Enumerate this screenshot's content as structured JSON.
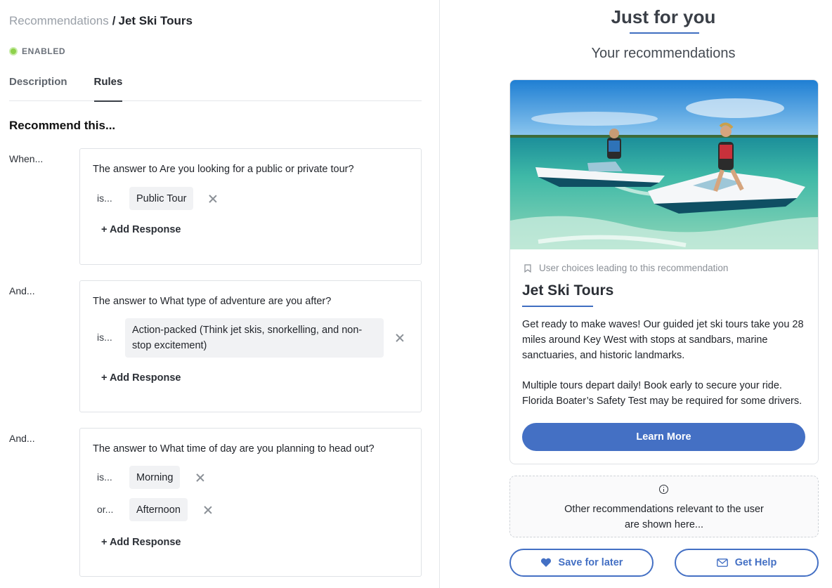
{
  "breadcrumb": {
    "parent": "Recommendations",
    "separator": "/",
    "current": "Jet Ski Tours"
  },
  "status": {
    "label": "ENABLED",
    "color": "#8ed14b"
  },
  "tabs": [
    {
      "label": "Description",
      "active": false
    },
    {
      "label": "Rules",
      "active": true
    }
  ],
  "rules": {
    "section_title": "Recommend this...",
    "conditions": [
      {
        "label": "When...",
        "question": "The answer to Are you looking for a public or private tour?",
        "responses": [
          {
            "op": "is...",
            "value": "Public Tour"
          }
        ],
        "add_label": "+ Add Response"
      },
      {
        "label": "And...",
        "question": "The answer to What type of adventure are you after?",
        "responses": [
          {
            "op": "is...",
            "value": "Action-packed (Think jet skis, snorkelling, and non-stop excitement)"
          }
        ],
        "add_label": "+ Add Response"
      },
      {
        "label": "And...",
        "question": "The answer to What time of day are you planning to head out?",
        "responses": [
          {
            "op": "is...",
            "value": "Morning"
          },
          {
            "op": "or...",
            "value": "Afternoon"
          }
        ],
        "add_label": "+ Add Response"
      }
    ]
  },
  "preview": {
    "heading": "Just for you",
    "subheading": "Your recommendations",
    "card": {
      "choice_note": "User choices leading to this recommendation",
      "title": "Jet Ski Tours",
      "desc_1": "Get ready to make waves! Our guided jet ski tours take you 28 miles around Key West with stops at sandbars, marine sanctuaries, and historic landmarks.",
      "desc_2": "Multiple tours depart daily! Book early to secure your ride. Florida Boater’s Safety Test may be required for some drivers.",
      "button": "Learn More"
    },
    "other_text_1": "Other recommendations relevant to the user",
    "other_text_2": "are shown here...",
    "save_button": "Save for later",
    "help_button": "Get Help"
  },
  "colors": {
    "accent": "#4470c4",
    "enabled": "#8ed14b"
  }
}
